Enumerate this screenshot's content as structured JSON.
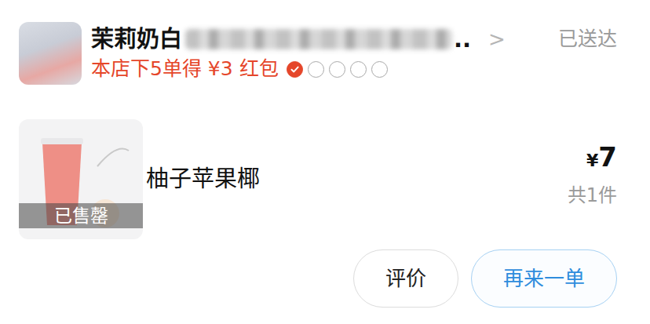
{
  "store": {
    "name": "茉莉奶白",
    "ellipsis": "..",
    "arrow": ">",
    "status": "已送达"
  },
  "promo": {
    "text": "本店下5单得 ¥3 红包",
    "steps": [
      {
        "done": true
      },
      {
        "done": false
      },
      {
        "done": false
      },
      {
        "done": false
      },
      {
        "done": false
      }
    ]
  },
  "items": [
    {
      "name": "柚子苹果椰",
      "currency": "¥",
      "price": "7",
      "count": "共1件",
      "sold_out": true,
      "badge": "已售罄"
    }
  ],
  "buttons": [
    {
      "label": "评价",
      "kind": "plain"
    },
    {
      "label": "再来一单",
      "kind": "primary"
    }
  ]
}
